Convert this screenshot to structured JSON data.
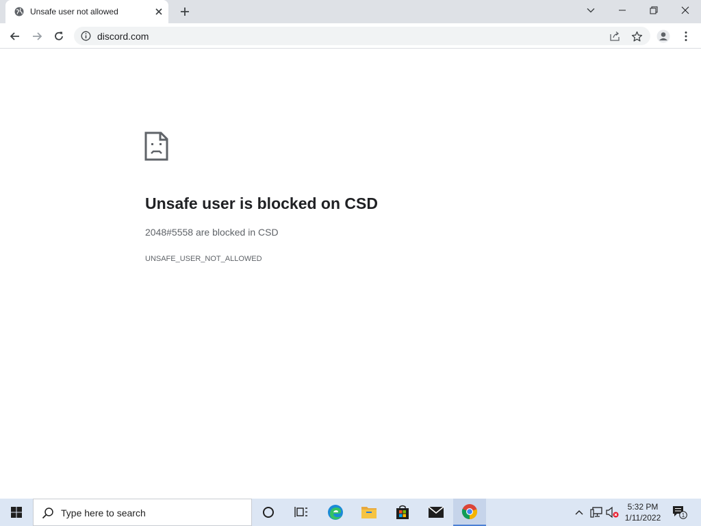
{
  "browser": {
    "tab": {
      "title": "Unsafe user not allowed",
      "favicon": "globe-icon"
    },
    "address": {
      "url": "discord.com",
      "security_icon": "info-icon"
    },
    "window_controls": [
      "chevron-down-icon",
      "minimize-icon",
      "restore-icon",
      "close-icon"
    ],
    "toolbar_icons": [
      "back-icon",
      "forward-icon",
      "reload-icon",
      "share-icon",
      "bookmark-star-icon",
      "profile-icon",
      "menu-icon"
    ]
  },
  "page": {
    "icon": "sad-page-icon",
    "title": "Unsafe user is blocked on CSD",
    "description": "2048#5558 are blocked in CSD",
    "error_code": "UNSAFE_USER_NOT_ALLOWED"
  },
  "taskbar": {
    "search_placeholder": "Type here to search",
    "apps": [
      "cortana-icon",
      "task-view-icon",
      "edge-icon",
      "file-explorer-icon",
      "store-icon",
      "mail-icon",
      "chrome-icon"
    ],
    "active_app": "chrome-icon",
    "tray_icons": [
      "show-hidden-icons-chevron",
      "network-icon",
      "volume-muted-icon"
    ],
    "time": "5:32 PM",
    "date": "1/11/2022",
    "notification_count": "1"
  },
  "colors": {
    "tabstrip": "#dee1e6",
    "omnibox": "#f1f3f4",
    "title_text": "#202124",
    "secondary_text": "#5f6368",
    "taskbar": "#dce6f4",
    "taskbar_active": "#c6d4ea"
  }
}
